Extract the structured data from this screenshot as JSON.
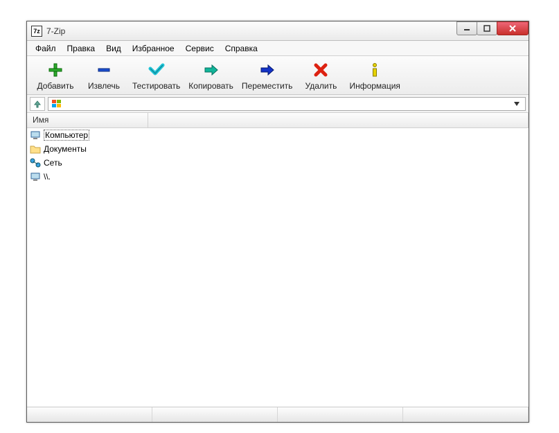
{
  "title": "7-Zip",
  "app_icon_text": "7z",
  "menu": {
    "file": "Файл",
    "edit": "Правка",
    "view": "Вид",
    "favorites": "Избранное",
    "tools": "Сервис",
    "help": "Справка"
  },
  "toolbar": {
    "add": "Добавить",
    "extract": "Извлечь",
    "test": "Тестировать",
    "copy": "Копировать",
    "move": "Переместить",
    "delete": "Удалить",
    "info": "Информация"
  },
  "address": {
    "value": ""
  },
  "columns": {
    "name": "Имя"
  },
  "items": [
    {
      "label": "Компьютер",
      "icon": "computer",
      "selected": true
    },
    {
      "label": "Документы",
      "icon": "folder",
      "selected": false
    },
    {
      "label": "Сеть",
      "icon": "network",
      "selected": false
    },
    {
      "label": "\\\\.",
      "icon": "computer",
      "selected": false
    }
  ]
}
